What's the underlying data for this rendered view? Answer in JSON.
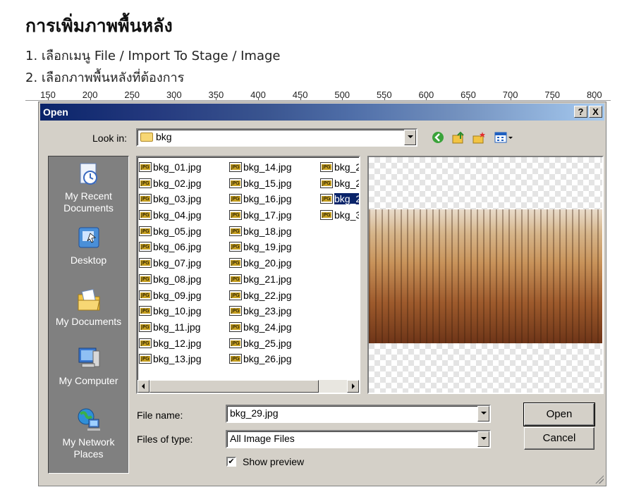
{
  "document": {
    "title": "การเพิ่มภาพพื้นหลัง",
    "step1": "1. เลือกเมนู File / Import To Stage / Image",
    "step2": "2. เลือกภาพพื้นหลังที่ต้องการ"
  },
  "ruler": {
    "labels": [
      "150",
      "200",
      "250",
      "300",
      "350",
      "400",
      "450",
      "500",
      "550",
      "600",
      "650",
      "700",
      "750",
      "800"
    ]
  },
  "dialog": {
    "title": "Open",
    "help_button": "?",
    "close_button": "X",
    "look_in_label": "Look in:",
    "look_in_value": "bkg",
    "places": [
      {
        "label": "My Recent\nDocuments",
        "icon": "recent-documents-icon"
      },
      {
        "label": "Desktop",
        "icon": "desktop-icon"
      },
      {
        "label": "My Documents",
        "icon": "my-documents-icon"
      },
      {
        "label": "My Computer",
        "icon": "my-computer-icon"
      },
      {
        "label": "My Network\nPlaces",
        "icon": "network-places-icon"
      }
    ],
    "files_col1": [
      "bkg_01.jpg",
      "bkg_02.jpg",
      "bkg_03.jpg",
      "bkg_04.jpg",
      "bkg_05.jpg",
      "bkg_06.jpg",
      "bkg_07.jpg",
      "bkg_08.jpg",
      "bkg_09.jpg",
      "bkg_10.jpg",
      "bkg_11.jpg",
      "bkg_12.jpg",
      "bkg_13.jpg"
    ],
    "files_col2": [
      "bkg_14.jpg",
      "bkg_15.jpg",
      "bkg_16.jpg",
      "bkg_17.jpg",
      "bkg_18.jpg",
      "bkg_19.jpg",
      "bkg_20.jpg",
      "bkg_21.jpg",
      "bkg_22.jpg",
      "bkg_23.jpg",
      "bkg_24.jpg",
      "bkg_25.jpg",
      "bkg_26.jpg"
    ],
    "files_col3": [
      "bkg_2",
      "bkg_2",
      "bkg_2",
      "bkg_3"
    ],
    "selected_index_col3": 2,
    "file_name_label": "File name:",
    "file_name_value": "bkg_29.jpg",
    "files_of_type_label": "Files of type:",
    "files_of_type_value": "All Image Files",
    "show_preview_label": "Show preview",
    "show_preview_checked": true,
    "open_button": "Open",
    "cancel_button": "Cancel"
  }
}
